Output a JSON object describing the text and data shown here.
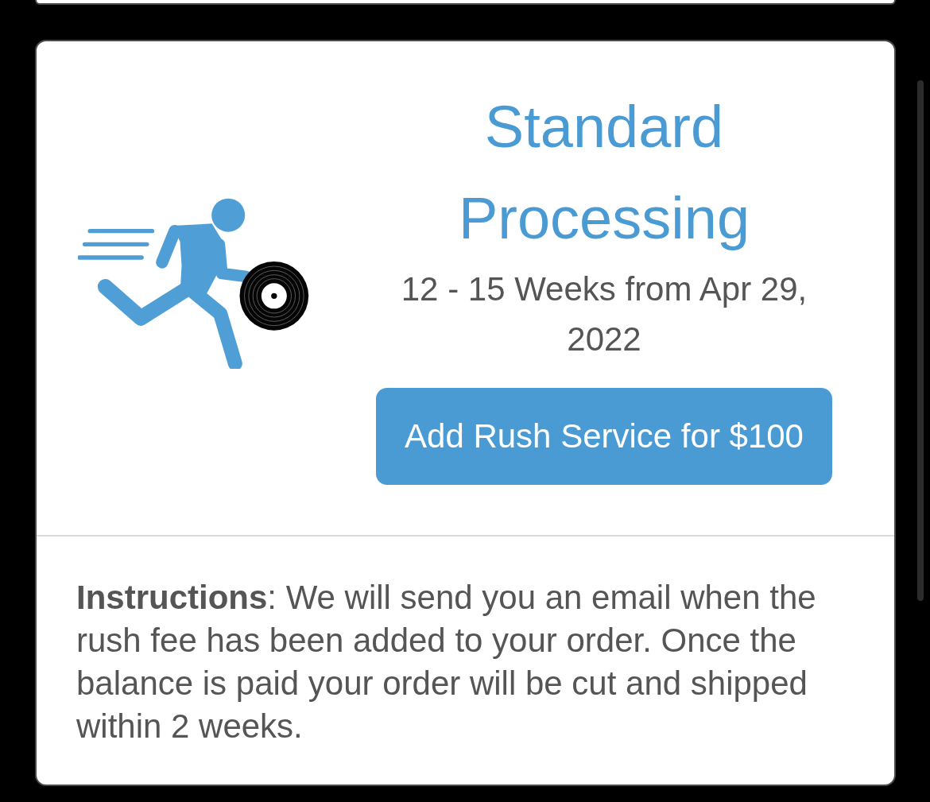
{
  "card": {
    "title": "Standard Processing",
    "estimate": "12 - 15 Weeks from Apr 29, 2022",
    "button": "Add Rush Service for $100",
    "instructions": "**Instructions**: We will send you an email when the rush fee has been added to your order. Once the balance is paid your order will be cut and shipped within 2 weeks."
  }
}
